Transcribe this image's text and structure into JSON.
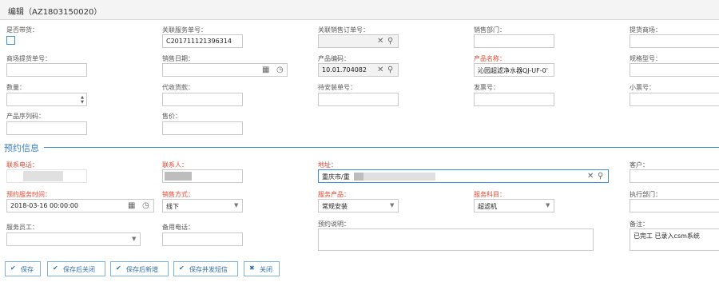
{
  "window": {
    "title": "编辑（AZ1803150020）"
  },
  "fields": {
    "with_goods": {
      "label": "是否带货：",
      "checked": false
    },
    "service_no": {
      "label": "关联服务单号：",
      "value": "C201711121396314"
    },
    "sales_order": {
      "label": "关联销售订单号：",
      "value": ""
    },
    "sales_dept": {
      "label": "销售部门：",
      "value": ""
    },
    "supply_mall": {
      "label": "提货商场：",
      "value": ""
    },
    "mall_order": {
      "label": "商场提货单号：",
      "value": ""
    },
    "sale_date": {
      "label": "销售日期：",
      "value": ""
    },
    "product_code": {
      "label": "产品编码：",
      "value": "10.01.704082"
    },
    "product_name": {
      "label": "产品名称：",
      "value": "沁园超滤净水器QJ-UF-0'"
    },
    "model": {
      "label": "规格型号：",
      "value": ""
    },
    "quantity": {
      "label": "数量：",
      "value": ""
    },
    "collect_payment": {
      "label": "代收货款：",
      "value": ""
    },
    "pending_install": {
      "label": "待安装单号：",
      "value": ""
    },
    "invoice_no": {
      "label": "发票号：",
      "value": ""
    },
    "receipt_no": {
      "label": "小票号：",
      "value": ""
    },
    "serial_no": {
      "label": "产品序列码：",
      "value": ""
    },
    "price": {
      "label": "售价：",
      "value": ""
    }
  },
  "section_title": "预约信息",
  "booking": {
    "phone": {
      "label": "联系电话：",
      "value": ""
    },
    "contact": {
      "label": "联系人：",
      "value": ""
    },
    "address": {
      "label": "地址：",
      "value": "重庆市/重"
    },
    "customer": {
      "label": "客户：",
      "value": ""
    },
    "appt_time": {
      "label": "预约服务时间：",
      "value": "2018-03-16 00:00:00"
    },
    "sale_method": {
      "label": "销售方式：",
      "value": "线下"
    },
    "service_product": {
      "label": "服务产品：",
      "value": "常规安装"
    },
    "service_item": {
      "label": "服务科目：",
      "value": "超滤机"
    },
    "exec_dept": {
      "label": "执行部门：",
      "value": ""
    },
    "staff": {
      "label": "服务员工：",
      "value": ""
    },
    "backup_phone": {
      "label": "备用电话：",
      "value": ""
    },
    "appt_desc": {
      "label": "预约说明：",
      "value": ""
    },
    "remark": {
      "label": "备注：",
      "value": "已完工 已录入csm系统"
    }
  },
  "buttons": {
    "save": "保存",
    "save_close": "保存后关闭",
    "save_new": "保存后新增",
    "save_sms": "保存并发短信",
    "close": "关闭"
  },
  "icons": {
    "clear": "close-icon",
    "search": "search-icon",
    "calendar": "calendar-icon",
    "clock": "clock-icon",
    "check": "check-icon",
    "caret": "caret-down-icon"
  },
  "colors": {
    "required": "#e8452f",
    "accent": "#3a8fd6",
    "button_text": "#2f6fb0"
  }
}
